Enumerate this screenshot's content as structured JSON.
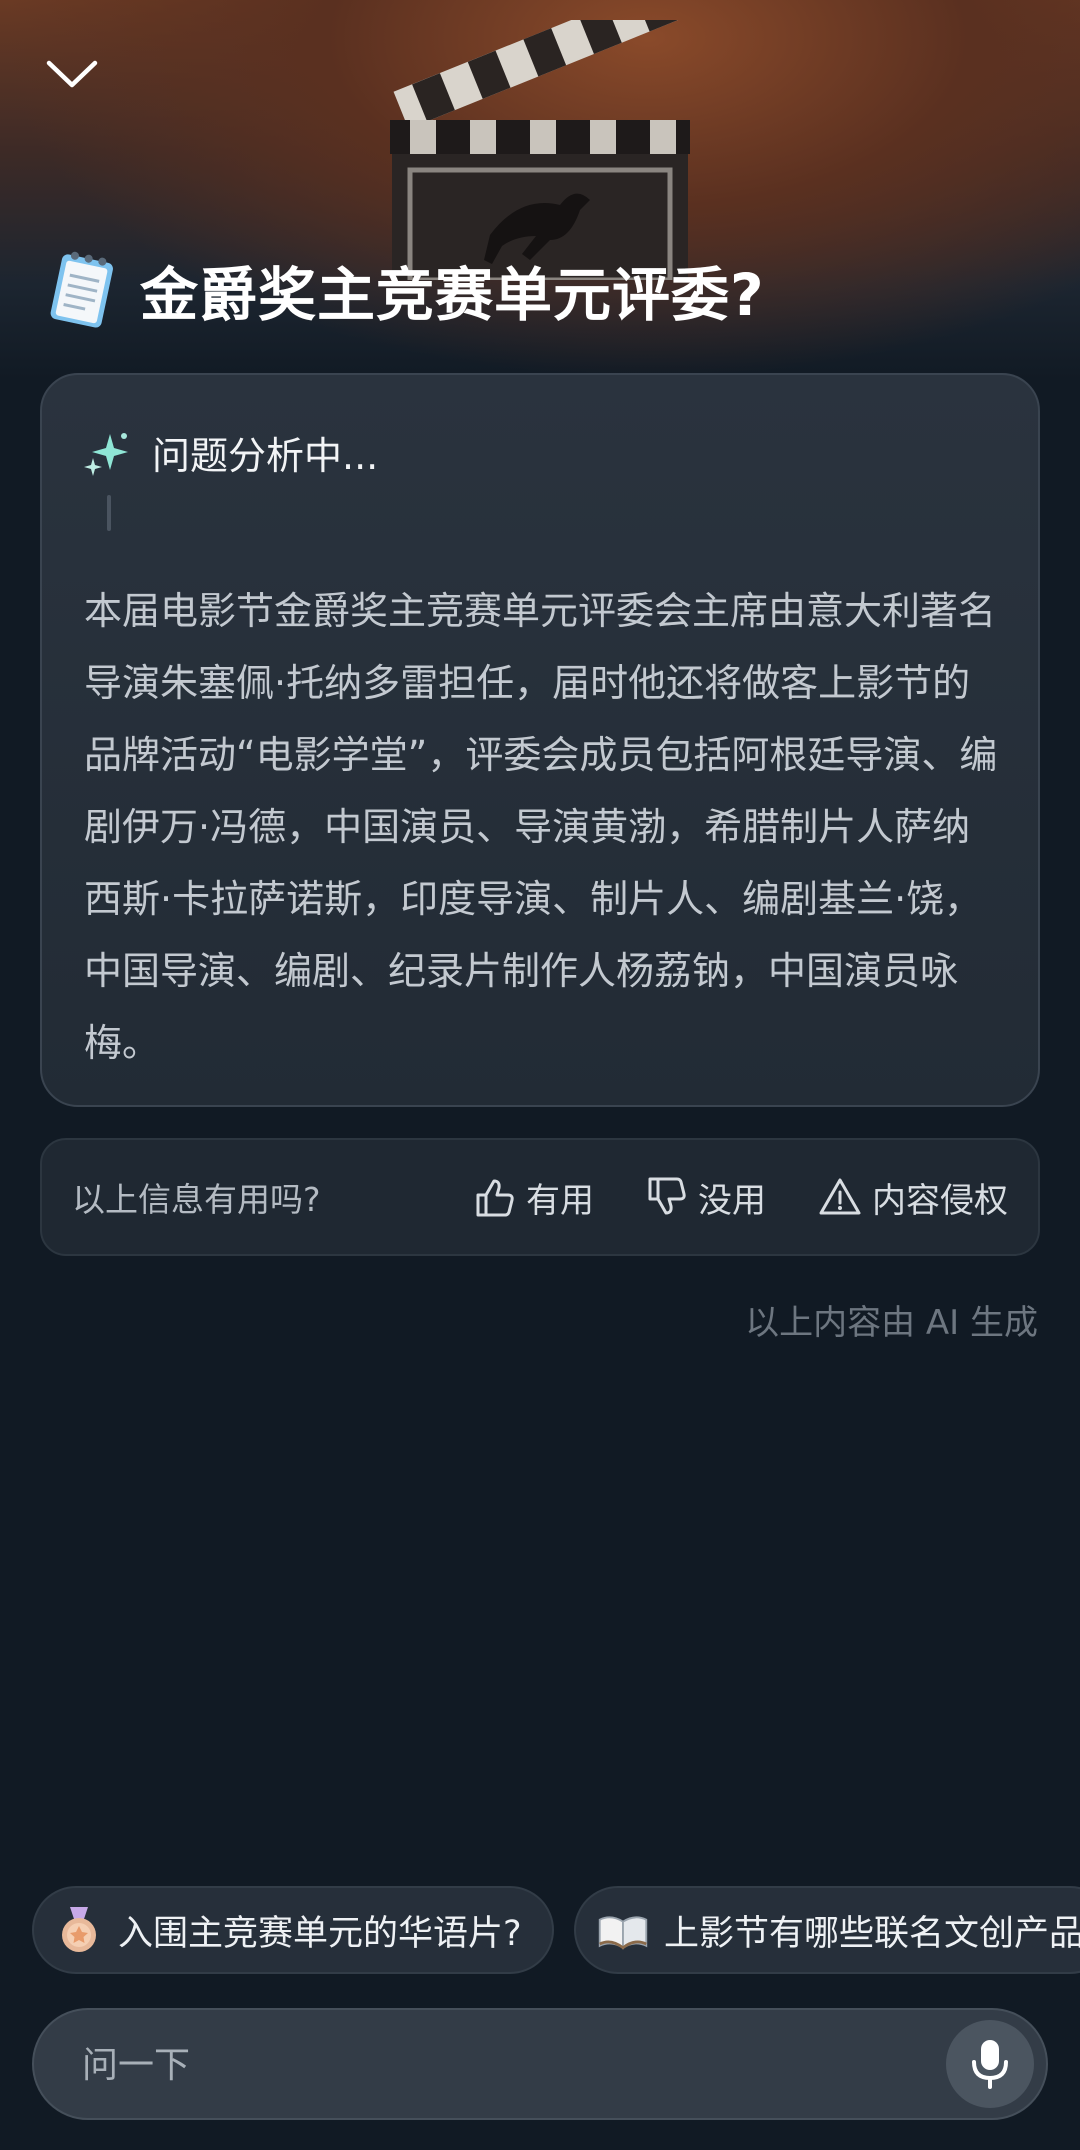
{
  "header": {
    "collapse_icon": "chevron-down-icon",
    "title_icon": "notepad-icon",
    "title": "金爵奖主竞赛单元评委?"
  },
  "analysis_card": {
    "status_icon": "sparkle-icon",
    "status_text": "问题分析中...",
    "answer": "本届电影节金爵奖主竞赛单元评委会主席由意大利著名导演朱塞佩·托纳多雷担任，届时他还将做客上影节的品牌活动“电影学堂”，评委会成员包括阿根廷导演、编剧伊万·冯德，中国演员、导演黄渤，希腊制片人萨纳西斯·卡拉萨诺斯，印度导演、制片人、编剧基兰·饶，中国导演、编剧、纪录片制作人杨荔钠，中国演员咏梅。"
  },
  "feedback": {
    "question": "以上信息有用吗?",
    "useful_label": "有用",
    "useless_label": "没用",
    "report_label": "内容侵权"
  },
  "ai_note": "以上内容由 AI 生成",
  "suggestions": [
    {
      "icon": "medal-icon",
      "label": "入围主竞赛单元的华语片?"
    },
    {
      "icon": "open-book-icon",
      "label": "上影节有哪些联名文创产品"
    }
  ],
  "input": {
    "placeholder": "问一下",
    "mic_icon": "microphone-icon"
  },
  "colors": {
    "background": "#111a24",
    "card": "#262f3a",
    "accent_sparkle": "#7fe0d0"
  }
}
